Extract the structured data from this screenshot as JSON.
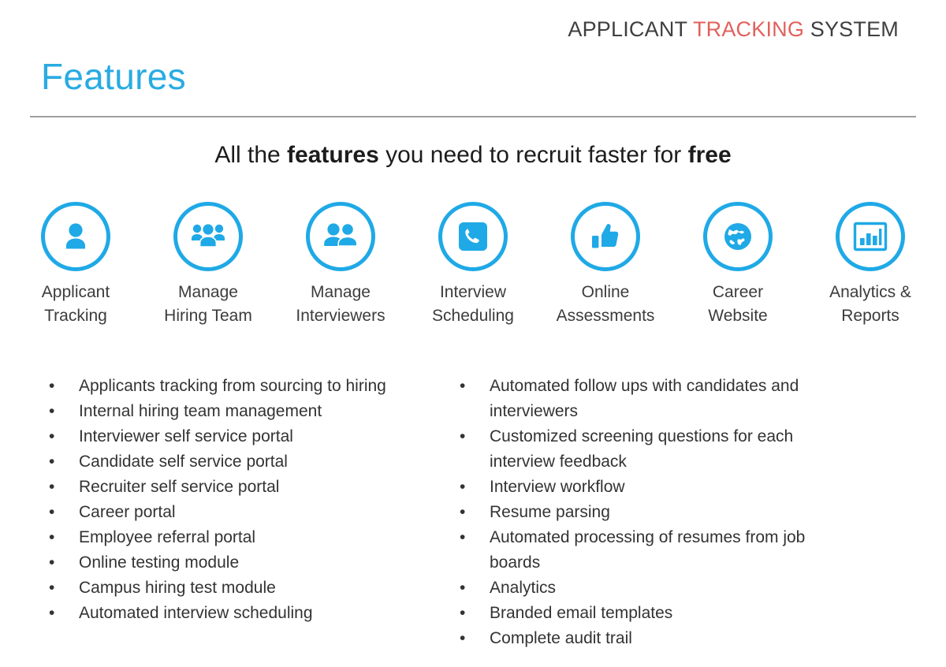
{
  "brand": {
    "word1": "APPLICANT",
    "word2": "TRACKING",
    "word3": "SYSTEM",
    "accent_color": "#e2615c",
    "dark_color": "#3f3f3f"
  },
  "title": {
    "text": "Features",
    "color": "#29abe2",
    "rule_color": "#7e7e7e"
  },
  "subtitle": {
    "part1": "All the ",
    "bold1": "features",
    "part2": " you need to recruit faster for ",
    "bold2": "free"
  },
  "features": {
    "accent_color": "#1fa9e6",
    "items": [
      {
        "icon": "single-person-icon",
        "line1": "Applicant",
        "line2": "Tracking"
      },
      {
        "icon": "people-group-icon",
        "line1": "Manage",
        "line2": "Hiring Team"
      },
      {
        "icon": "two-people-icon",
        "line1": "Manage",
        "line2": "Interviewers"
      },
      {
        "icon": "phone-handset-icon",
        "line1": "Interview",
        "line2": "Scheduling"
      },
      {
        "icon": "thumbs-up-icon",
        "line1": "Online",
        "line2": "Assessments"
      },
      {
        "icon": "globe-icon",
        "line1": "Career",
        "line2": "Website"
      },
      {
        "icon": "bar-chart-icon",
        "line1": "Analytics &",
        "line2": "Reports"
      }
    ]
  },
  "bullets": {
    "marker": "•",
    "left": [
      "Applicants tracking from sourcing to hiring",
      "Internal hiring team management",
      "Interviewer self service portal",
      "Candidate self service portal",
      "Recruiter self service portal",
      "Career portal",
      "Employee referral portal",
      "Online testing module",
      "Campus hiring test module",
      "Automated interview scheduling"
    ],
    "right": [
      "Automated follow ups with candidates and interviewers",
      "Customized screening questions for each interview feedback",
      "Interview workflow",
      "Resume parsing",
      "Automated processing of resumes from job boards",
      "Analytics",
      "Branded email templates",
      "Complete audit trail"
    ]
  }
}
